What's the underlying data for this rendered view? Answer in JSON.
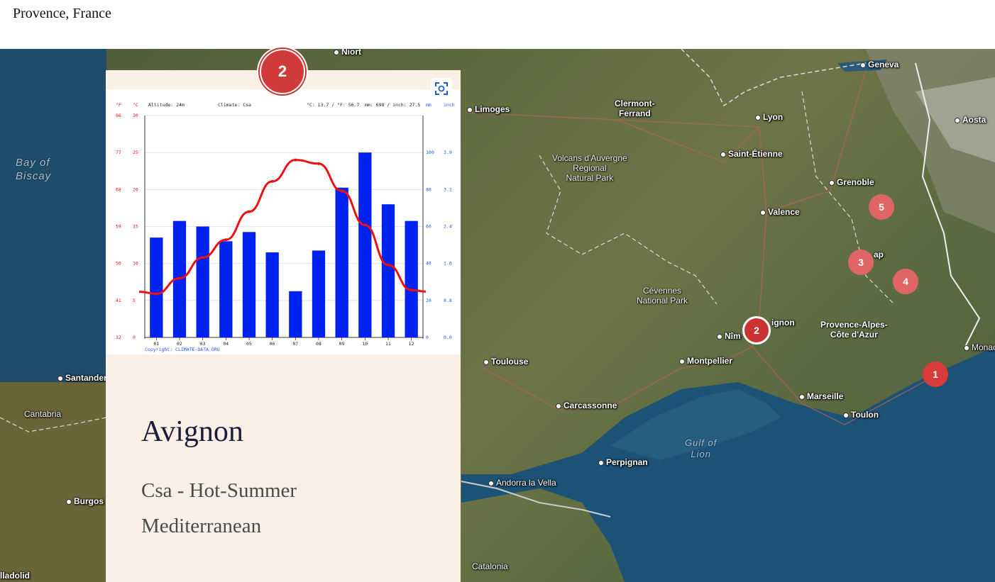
{
  "page": {
    "title": "Provence, France"
  },
  "map": {
    "cities": [
      {
        "id": "niort",
        "name": "Niort"
      },
      {
        "id": "limoges",
        "name": "Limoges"
      },
      {
        "id": "clermont",
        "name": "Clermont-\nFerrand"
      },
      {
        "id": "lyon",
        "name": "Lyon"
      },
      {
        "id": "geneva",
        "name": "Geneva"
      },
      {
        "id": "aosta",
        "name": "Aosta"
      },
      {
        "id": "saint-etienne",
        "name": "Saint-Étienne"
      },
      {
        "id": "grenoble",
        "name": "Grenoble"
      },
      {
        "id": "valence",
        "name": "Valence"
      },
      {
        "id": "avignon",
        "name": "ignon"
      },
      {
        "id": "nimes",
        "name": "Nîm"
      },
      {
        "id": "gap",
        "name": "ap"
      },
      {
        "id": "montpellier",
        "name": "Montpellier"
      },
      {
        "id": "toulouse",
        "name": "Toulouse"
      },
      {
        "id": "carcassonne",
        "name": "Carcassonne"
      },
      {
        "id": "perpignan",
        "name": "Perpignan"
      },
      {
        "id": "marseille",
        "name": "Marseille"
      },
      {
        "id": "toulon",
        "name": "Toulon"
      },
      {
        "id": "monaco",
        "name": "Monac"
      },
      {
        "id": "andorra",
        "name": "Andorra la Vella"
      },
      {
        "id": "catalonia",
        "name": "Catalonia"
      },
      {
        "id": "santander",
        "name": "Santander"
      },
      {
        "id": "cantabria",
        "name": "Cantabria"
      },
      {
        "id": "burgos",
        "name": "Burgos"
      },
      {
        "id": "valladolid",
        "name": "lladolid"
      }
    ],
    "regions": [
      {
        "id": "volcans",
        "name": "Volcans d'Auvergne\nRegional\nNatural Park"
      },
      {
        "id": "cevennes",
        "name": "Cévennes\nNational Park"
      },
      {
        "id": "paca",
        "name": "Provence-Alpes-\nCôte d'Azur"
      }
    ],
    "waters": [
      {
        "id": "biscay",
        "name": "Bay of\nBiscay"
      },
      {
        "id": "lion",
        "name": "Gulf of\nLion"
      }
    ],
    "markers": [
      {
        "id": "m1",
        "label": "1"
      },
      {
        "id": "m2",
        "label": "2"
      },
      {
        "id": "m3",
        "label": "3"
      },
      {
        "id": "m4",
        "label": "4"
      },
      {
        "id": "m5",
        "label": "5"
      }
    ],
    "active_badge": "2"
  },
  "card": {
    "name": "Avignon",
    "climate": "Csa - Hot-Summer Mediterranean"
  },
  "chart_data": {
    "type": "bar",
    "header": {
      "f_unit": "°F",
      "c_unit": "°C",
      "altitude": "Altitude: 24m",
      "climate": "Climate: Csa",
      "avg_temp": "°C: 13.7 / °F: 56.7",
      "precip": "mm: 698 / inch: 27.5",
      "mm_unit": "mm",
      "inch_unit": "inch"
    },
    "categories": [
      "01",
      "02",
      "03",
      "04",
      "05",
      "06",
      "07",
      "08",
      "09",
      "10",
      "11",
      "12"
    ],
    "series": [
      {
        "values": [
          54,
          63,
          60,
          52,
          57,
          46,
          25,
          47,
          81,
          100,
          72,
          63
        ],
        "color": "#0022ee",
        "axis": "mm"
      },
      {
        "values": [
          5.9,
          8.0,
          10.8,
          13.2,
          17.0,
          21.1,
          24.0,
          23.5,
          19.8,
          15.2,
          9.8,
          6.4
        ],
        "color": "#ee1111",
        "axis": "°C",
        "kind": "line"
      }
    ],
    "left_ticks_c": [
      "30",
      "25",
      "20",
      "15",
      "10",
      "5",
      "0"
    ],
    "left_ticks_f": [
      "86",
      "77",
      "68",
      "59",
      "50",
      "41",
      "32"
    ],
    "right_ticks_mm": [
      "100",
      "80",
      "60",
      "40",
      "20",
      "0"
    ],
    "right_ticks_inch": [
      "3.9",
      "3.1",
      "2.4",
      "1.6",
      "0.8",
      "0.0"
    ],
    "c_range": [
      0,
      30
    ],
    "mm_range": [
      0,
      120
    ],
    "copyright": "Copyright: CLIMATE-DATA.ORG"
  }
}
